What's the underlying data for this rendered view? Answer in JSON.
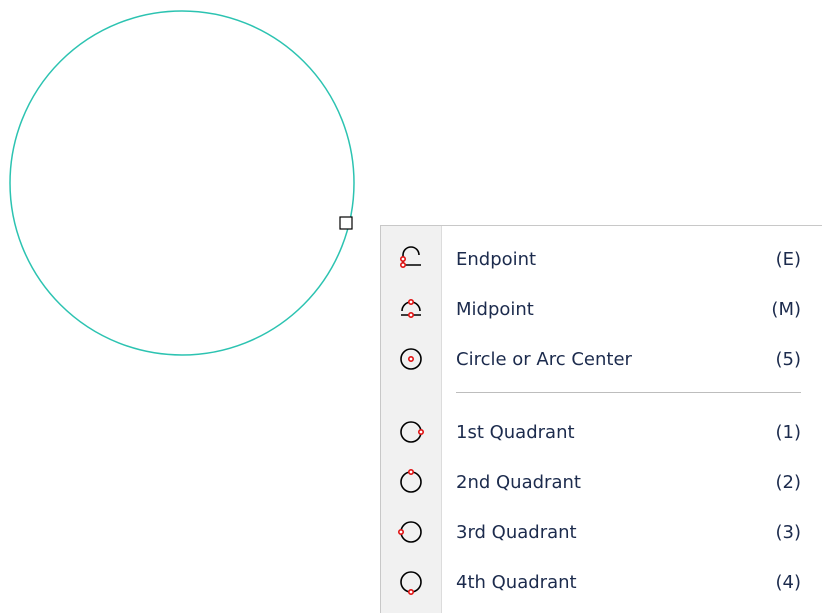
{
  "drawing": {
    "circle_color": "#2cc3b1",
    "marker_color": "#000000"
  },
  "snap_menu": {
    "items": [
      {
        "label": "Endpoint",
        "shortcut": "(E)",
        "icon": "endpoint-icon"
      },
      {
        "label": "Midpoint",
        "shortcut": "(M)",
        "icon": "midpoint-icon"
      },
      {
        "label": "Circle or Arc Center",
        "shortcut": "(5)",
        "icon": "center-icon"
      },
      {
        "label": "1st Quadrant",
        "shortcut": "(1)",
        "icon": "quadrant-1-icon"
      },
      {
        "label": "2nd Quadrant",
        "shortcut": "(2)",
        "icon": "quadrant-2-icon"
      },
      {
        "label": "3rd Quadrant",
        "shortcut": "(3)",
        "icon": "quadrant-3-icon"
      },
      {
        "label": "4th Quadrant",
        "shortcut": "(4)",
        "icon": "quadrant-4-icon"
      }
    ],
    "accent_color": "#e01010"
  }
}
